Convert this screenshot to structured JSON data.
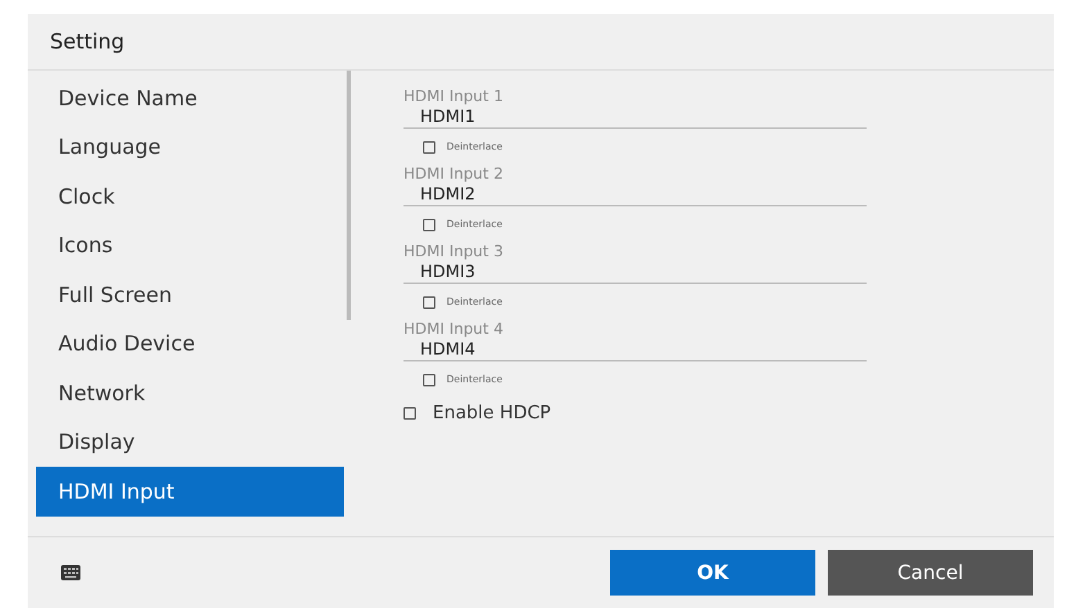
{
  "window": {
    "title": "Setting"
  },
  "sidebar": {
    "items": [
      {
        "label": "Device Name",
        "selected": false
      },
      {
        "label": "Language",
        "selected": false
      },
      {
        "label": "Clock",
        "selected": false
      },
      {
        "label": "Icons",
        "selected": false
      },
      {
        "label": "Full Screen",
        "selected": false
      },
      {
        "label": "Audio Device",
        "selected": false
      },
      {
        "label": "Network",
        "selected": false
      },
      {
        "label": "Display",
        "selected": false
      },
      {
        "label": "HDMI Input",
        "selected": true
      }
    ]
  },
  "inputs": [
    {
      "label": "HDMI Input 1",
      "value": "HDMI1",
      "option": "Deinterlace",
      "checked": false
    },
    {
      "label": "HDMI Input 2",
      "value": "HDMI2",
      "option": "Deinterlace",
      "checked": false
    },
    {
      "label": "HDMI Input 3",
      "value": "HDMI3",
      "option": "Deinterlace",
      "checked": false
    },
    {
      "label": "HDMI Input 4",
      "value": "HDMI4",
      "option": "Deinterlace",
      "checked": false
    }
  ],
  "hdcp": {
    "label": "Enable HDCP",
    "checked": false
  },
  "buttons": [
    {
      "label": "OK",
      "kind": "primary"
    },
    {
      "label": "Cancel",
      "kind": "secondary"
    }
  ]
}
